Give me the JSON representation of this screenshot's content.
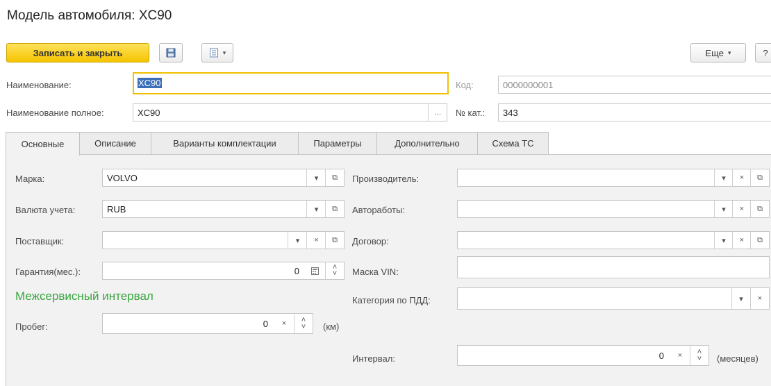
{
  "window": {
    "title": "Модель автомобиля: XC90"
  },
  "toolbar": {
    "save_close_label": "Записать и закрыть",
    "more_label": "Еще",
    "help_label": "?"
  },
  "header": {
    "name_label": "Наименование:",
    "name_value": "XC90",
    "code_label": "Код:",
    "code_value": "0000000001",
    "full_name_label": "Наименование полное:",
    "full_name_value": "XC90",
    "cat_label": "№ кат.:",
    "cat_value": "343"
  },
  "tabs": [
    {
      "label": "Основные"
    },
    {
      "label": "Описание"
    },
    {
      "label": "Варианты комплектации"
    },
    {
      "label": "Параметры"
    },
    {
      "label": "Дополнительно"
    },
    {
      "label": "Схема ТС"
    }
  ],
  "main": {
    "brand_label": "Марка:",
    "brand_value": "VOLVO",
    "currency_label": "Валюта учета:",
    "currency_value": "RUB",
    "supplier_label": "Поставщик:",
    "supplier_value": "",
    "warranty_label": "Гарантия(мес.):",
    "warranty_value": "0",
    "section_title": "Межсервисный интервал",
    "mileage_label": "Пробег:",
    "mileage_value": "0",
    "mileage_unit": "(км)",
    "manufacturer_label": "Производитель:",
    "manufacturer_value": "",
    "autowork_label": "Автоработы:",
    "autowork_value": "",
    "contract_label": "Договор:",
    "contract_value": "",
    "vin_label": "Маска VIN:",
    "vin_value": "",
    "category_label": "Категория по ПДД:",
    "category_value": "",
    "interval_label": "Интервал:",
    "interval_value": "0",
    "interval_unit": "(месяцев)"
  },
  "glyphs": {
    "dropdown": "▾",
    "open": "⧉",
    "clear": "×",
    "ellipsis": "...",
    "up": "˄",
    "down": "˅"
  },
  "colors": {
    "primary_button": "#f5c400",
    "section_title": "#3aa540",
    "selection": "#3c6fb8",
    "focus_border": "#f0c000"
  }
}
